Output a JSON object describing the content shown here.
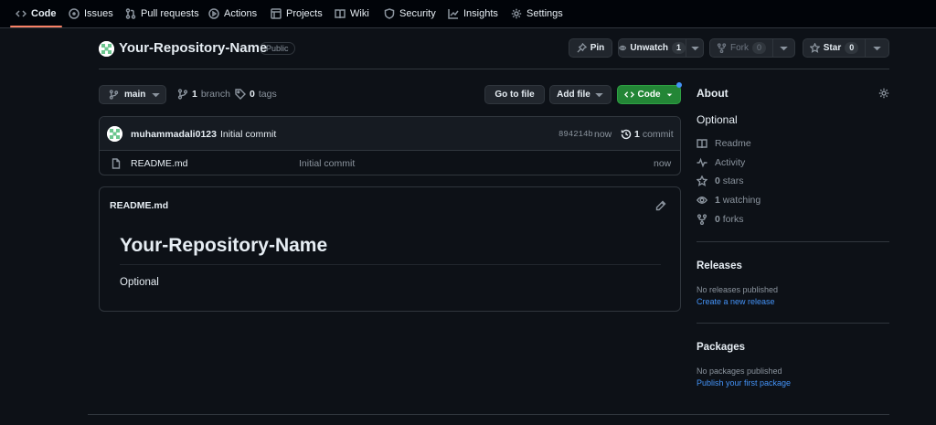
{
  "nav": {
    "tabs": [
      {
        "label": "Code",
        "icon": "code-icon"
      },
      {
        "label": "Issues",
        "icon": "issue-icon"
      },
      {
        "label": "Pull requests",
        "icon": "pull-request-icon"
      },
      {
        "label": "Actions",
        "icon": "play-icon"
      },
      {
        "label": "Projects",
        "icon": "table-icon"
      },
      {
        "label": "Wiki",
        "icon": "book-icon"
      },
      {
        "label": "Security",
        "icon": "shield-icon"
      },
      {
        "label": "Insights",
        "icon": "graph-icon"
      },
      {
        "label": "Settings",
        "icon": "gear-icon"
      }
    ]
  },
  "repo": {
    "name": "Your-Repository-Name",
    "visibility": "Public",
    "pin_label": "Pin",
    "unwatch_label": "Unwatch",
    "watch_count": "1",
    "fork_label": "Fork",
    "fork_count": "0",
    "star_label": "Star",
    "star_count": "0"
  },
  "toolbar": {
    "branch": "main",
    "branch_count": "1",
    "branch_word": "branch",
    "tag_count": "0",
    "tag_word": "tags",
    "go_to_file": "Go to file",
    "add_file": "Add file",
    "code": "Code"
  },
  "commit": {
    "author": "muhammadali0123",
    "message": "Initial commit",
    "hash": "894214b",
    "time": "now",
    "count": "1",
    "count_word": "commit"
  },
  "files": [
    {
      "name": "README.md",
      "message": "Initial commit",
      "time": "now"
    }
  ],
  "readme": {
    "filename": "README.md",
    "heading": "Your-Repository-Name",
    "body": "Optional"
  },
  "about": {
    "title": "About",
    "description": "Optional",
    "items": [
      {
        "icon": "book-icon",
        "strong": "",
        "text": "Readme"
      },
      {
        "icon": "pulse-icon",
        "strong": "",
        "text": "Activity"
      },
      {
        "icon": "star-icon",
        "strong": "0",
        "text": "stars"
      },
      {
        "icon": "eye-icon",
        "strong": "1",
        "text": "watching"
      },
      {
        "icon": "fork-icon",
        "strong": "0",
        "text": "forks"
      }
    ]
  },
  "releases": {
    "title": "Releases",
    "empty": "No releases published",
    "link": "Create a new release"
  },
  "packages": {
    "title": "Packages",
    "empty": "No packages published",
    "link": "Publish your first package"
  },
  "colors": {
    "accent_green": "#238636",
    "link_blue": "#4493f8",
    "tab_underline": "#f78166",
    "background": "#0d1117"
  }
}
